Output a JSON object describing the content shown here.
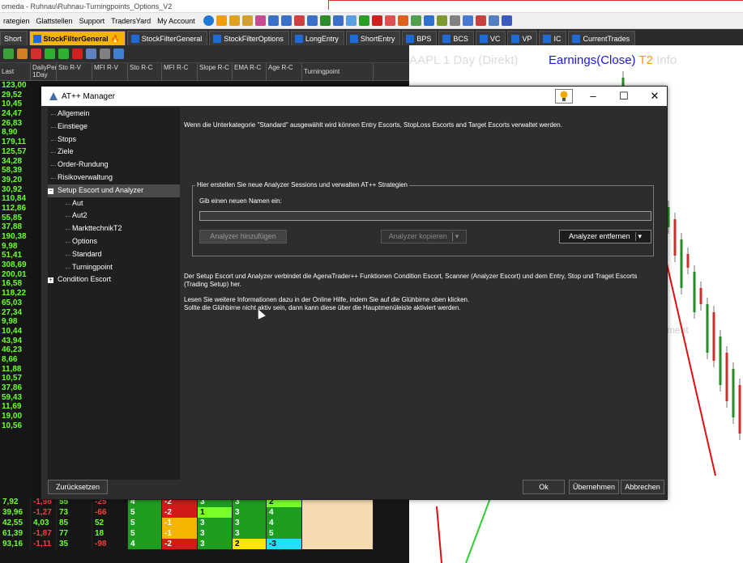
{
  "app": {
    "title": "omeda - Ruhnau\\Ruhnau-Turningpoints_Options_V2"
  },
  "menu": {
    "items": [
      "rategien",
      "Glattstellen",
      "Support",
      "TradersYard",
      "My Account"
    ]
  },
  "tabs": [
    {
      "label": "Short",
      "active": false
    },
    {
      "label": "StockFilterGeneral",
      "active": true
    },
    {
      "label": "StockFilterGeneral",
      "active": false
    },
    {
      "label": "StockFilterOptions",
      "active": false
    },
    {
      "label": "LongEntry",
      "active": false
    },
    {
      "label": "ShortEntry",
      "active": false
    },
    {
      "label": "BPS",
      "active": false
    },
    {
      "label": "BCS",
      "active": false
    },
    {
      "label": "VC",
      "active": false
    },
    {
      "label": "VP",
      "active": false
    },
    {
      "label": "IC",
      "active": false
    },
    {
      "label": "CurrentTrades",
      "active": false
    }
  ],
  "grid": {
    "columns": [
      "Last",
      "DailyPerfo 1Day",
      "Sto R-V",
      "MFI R-V",
      "Sto R-C",
      "MFI R-C",
      "Slope R-C",
      "EMA R-C",
      "Age R-C",
      "Turningpoint"
    ],
    "last_values": [
      "123,00",
      "29,52",
      "10,45",
      "24,47",
      "26,83",
      "8,90",
      "179,11",
      "125,57",
      "34,28",
      "58,39",
      "39,20",
      "30,92",
      "110,84",
      "112,86",
      "55,85",
      "37,88",
      "190,38",
      "9,98",
      "51,41",
      "308,69",
      "200,01",
      "16,58",
      "118,22",
      "65,03",
      "27,34",
      "9,98",
      "10,44",
      "43,94",
      "46,23",
      "8,66",
      "11,88",
      "10,57",
      "37,86",
      "59,43",
      "11,69",
      "19,00",
      "10,56"
    ],
    "bottom_rows": [
      [
        "7,92",
        "-1,98",
        "55",
        "-25",
        "4",
        "-2",
        "3",
        "3",
        "2"
      ],
      [
        "39,96",
        "-1,27",
        "73",
        "-66",
        "5",
        "-2",
        "1",
        "3",
        "4"
      ],
      [
        "42,55",
        "4,03",
        "85",
        "52",
        "5",
        "-1",
        "3",
        "3",
        "4"
      ],
      [
        "61,39",
        "-1,87",
        "77",
        "18",
        "5",
        "-1",
        "3",
        "3",
        "5"
      ],
      [
        "93,16",
        "-1,11",
        "35",
        "-98",
        "4",
        "-2",
        "3",
        "2",
        "-3"
      ]
    ]
  },
  "chart": {
    "ghost_title": "AAPL 1 Day (Direkt)",
    "indicator": "Earnings(Close)",
    "t2": "T2",
    "info": "Info",
    "annotation": "ment"
  },
  "dialog": {
    "title": "AT++ Manager",
    "tree": [
      {
        "label": "Allgemein",
        "level": 0
      },
      {
        "label": "Einstiege",
        "level": 0
      },
      {
        "label": "Stops",
        "level": 0
      },
      {
        "label": "Ziele",
        "level": 0
      },
      {
        "label": "Order-Rundung",
        "level": 0
      },
      {
        "label": "Risikoverwaltung",
        "level": 0
      },
      {
        "label": "Setup Escort und Analyzer",
        "level": 0,
        "expanded": true,
        "selected": true
      },
      {
        "label": "Aut",
        "level": 1
      },
      {
        "label": "Aut2",
        "level": 1
      },
      {
        "label": "MarkttechnikT2",
        "level": 1
      },
      {
        "label": "Options",
        "level": 1
      },
      {
        "label": "Standard",
        "level": 1
      },
      {
        "label": "Turningpoint",
        "level": 1
      },
      {
        "label": "Condition Escort",
        "level": 0,
        "expanded": false
      }
    ],
    "info_text": "Wenn die Unterkategorie \"Standard\" ausgewählt wird können Entry Escorts, StopLoss Escorts and Target Escorts verwaltet werden.",
    "group_legend": "Hier erstellen Sie neue Analyzer Sessions und verwalten AT++ Strategien",
    "name_label": "Gib einen neuen Namen ein:",
    "name_value": "",
    "btn_add": "Analyzer hinzufügen",
    "btn_copy": "Analyzer kopieren",
    "btn_remove": "Analyzer entfernen",
    "desc1": "Der Setup Escort und Analyzer verbindet die AgenaTrader++ Funktionen Condition Escort, Scanner (Analyzer Escort) und dem Entry, Stop und Traget Escorts (Trading Setup) her.",
    "desc2": "Lesen Sie weitere Informationen dazu in der Online Hilfe, indem Sie auf die Glühbirne oben klicken.",
    "desc3": "Sollte die Glühbirne nicht aktiv sein, dann kann diese über die Hauptmenüleiste aktiviert werden.",
    "btn_reset": "Zurücksetzen",
    "btn_ok": "Ok",
    "btn_apply": "Übernehmen",
    "btn_cancel": "Abbrechen"
  }
}
